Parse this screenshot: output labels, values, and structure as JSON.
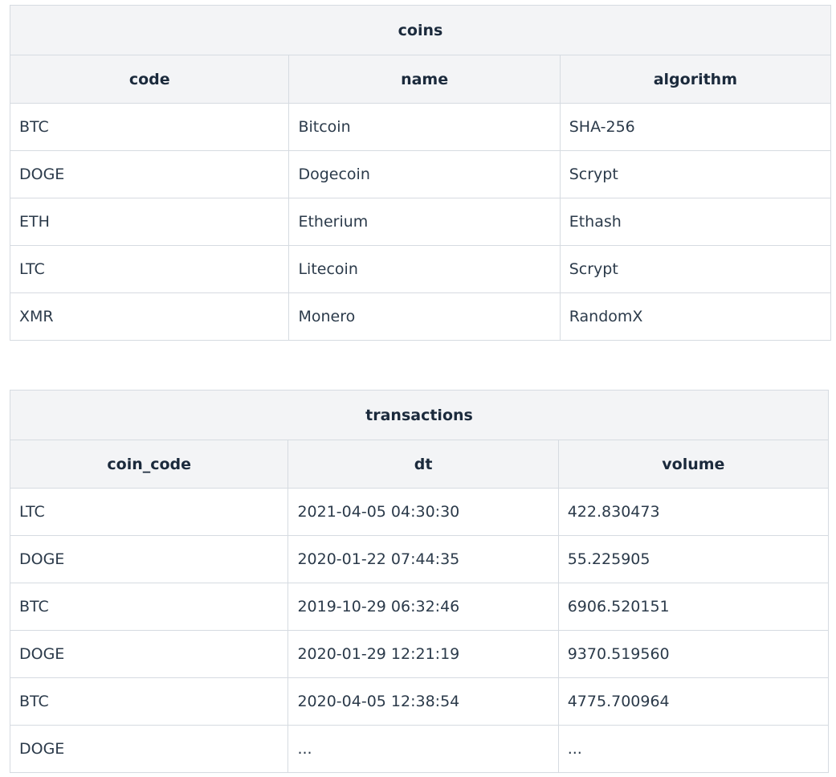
{
  "coins": {
    "title": "coins",
    "headers": [
      "code",
      "name",
      "algorithm"
    ],
    "rows": [
      [
        "BTC",
        "Bitcoin",
        "SHA-256"
      ],
      [
        "DOGE",
        "Dogecoin",
        "Scrypt"
      ],
      [
        "ETH",
        "Etherium",
        "Ethash"
      ],
      [
        "LTC",
        "Litecoin",
        "Scrypt"
      ],
      [
        "XMR",
        "Monero",
        "RandomX"
      ]
    ]
  },
  "transactions": {
    "title": "transactions",
    "headers": [
      "coin_code",
      "dt",
      "volume"
    ],
    "rows": [
      [
        "LTC",
        "2021-04-05 04:30:30",
        "422.830473"
      ],
      [
        "DOGE",
        "2020-01-22 07:44:35",
        "55.225905"
      ],
      [
        "BTC",
        "2019-10-29 06:32:46",
        "6906.520151"
      ],
      [
        "DOGE",
        "2020-01-29 12:21:19",
        "9370.519560"
      ],
      [
        "BTC",
        "2020-04-05 12:38:54",
        "4775.700964"
      ],
      [
        "DOGE",
        "...",
        "..."
      ]
    ]
  }
}
